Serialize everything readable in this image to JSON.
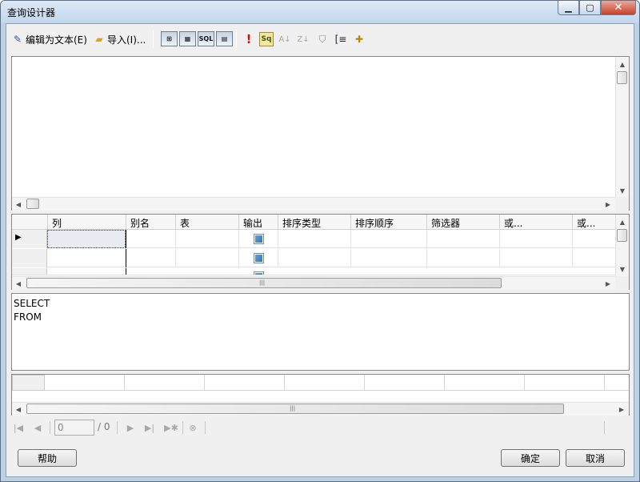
{
  "window": {
    "title": "查询设计器"
  },
  "toolbar": {
    "edit_as_text": "编辑为文本(E)",
    "import": "导入(I)...",
    "sql_toggle": "SQL"
  },
  "grid": {
    "columns": [
      "列",
      "别名",
      "表",
      "输出",
      "排序类型",
      "排序顺序",
      "筛选器",
      "或...",
      "或..."
    ]
  },
  "sql": {
    "text": "SELECT\nFROM"
  },
  "navigator": {
    "page_value": "0",
    "total": "/ 0"
  },
  "buttons": {
    "help": "帮助",
    "ok": "确定",
    "cancel": "取消"
  }
}
